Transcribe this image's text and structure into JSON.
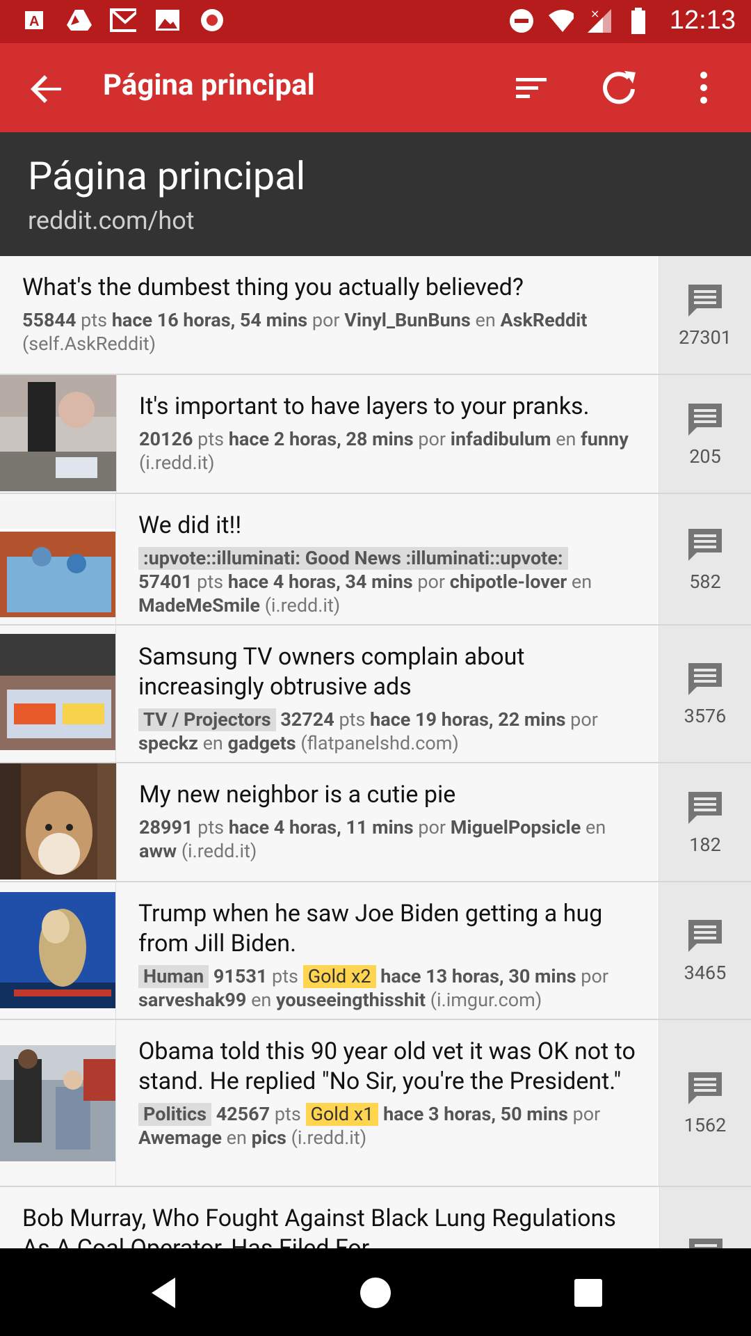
{
  "status_bar": {
    "time": "12:13",
    "left_icons": [
      "adobe-icon",
      "drive-icon",
      "gmail-icon",
      "photos-icon",
      "record-icon"
    ],
    "right_icons": [
      "do-not-disturb-icon",
      "wifi-icon",
      "signal-icon",
      "battery-icon"
    ]
  },
  "app_bar": {
    "title": "Página principal",
    "actions": [
      "sort-icon",
      "refresh-icon",
      "more-vert-icon"
    ]
  },
  "header": {
    "title": "Página principal",
    "subtitle": "reddit.com/hot"
  },
  "posts": [
    {
      "title": "What's the dumbest thing you actually believed?",
      "points": "55844",
      "pts_label": "pts",
      "time": "hace 16 horas, 54 mins",
      "por": "por",
      "author": "Vinyl_BunBuns",
      "en": "en",
      "subreddit": "AskReddit",
      "domain": "(self.AskReddit)",
      "comments": "27301",
      "has_thumb": false
    },
    {
      "title": "It's important to have layers to your pranks.",
      "points": "20126",
      "pts_label": "pts",
      "time": "hace 2 horas, 28 mins",
      "por": "por",
      "author": "infadibulum",
      "en": "en",
      "subreddit": "funny",
      "domain": "(i.redd.it)",
      "comments": "205",
      "has_thumb": true
    },
    {
      "title": "We did it!!",
      "flair": ":upvote::illuminati: Good News :illuminati::upvote:",
      "points": "57401",
      "pts_label": "pts",
      "time": "hace 4 horas, 34 mins",
      "por": "por",
      "author": "chipotle-lover",
      "en": "en",
      "subreddit": "MadeMeSmile",
      "domain": "(i.redd.it)",
      "comments": "582",
      "has_thumb": true
    },
    {
      "title": "Samsung TV owners complain about increasingly obtrusive ads",
      "flair": "TV / Projectors",
      "points": "32724",
      "pts_label": "pts",
      "time": "hace 19 horas, 22 mins",
      "por": "por",
      "author": "speckz",
      "en": "en",
      "subreddit": "gadgets",
      "domain": "(flatpanelshd.com)",
      "comments": "3576",
      "has_thumb": true
    },
    {
      "title": "My new neighbor is a cutie pie",
      "points": "28991",
      "pts_label": "pts",
      "time": "hace 4 horas, 11 mins",
      "por": "por",
      "author": "MiguelPopsicle",
      "en": "en",
      "subreddit": "aww",
      "domain": "(i.redd.it)",
      "comments": "182",
      "has_thumb": true
    },
    {
      "title": "Trump when he saw Joe Biden getting a hug from Jill Biden.",
      "flair": "Human",
      "points": "91531",
      "pts_label": "pts",
      "gold": "Gold x2",
      "time": "hace 13 horas, 30 mins",
      "por": "por",
      "author": "sarveshak99",
      "en": "en",
      "subreddit": "youseeingthisshit",
      "domain": "(i.imgur.com)",
      "comments": "3465",
      "has_thumb": true
    },
    {
      "title": "Obama told this 90 year old vet it was OK not to stand. He replied \"No Sir, you're the President.\"",
      "flair": "Politics",
      "points": "42567",
      "pts_label": "pts",
      "gold": "Gold x1",
      "time": "hace 3 horas, 50 mins",
      "por": "por",
      "author": "Awemage",
      "en": "en",
      "subreddit": "pics",
      "domain": "(i.redd.it)",
      "comments": "1562",
      "has_thumb": true
    },
    {
      "title": "Bob Murray, Who Fought Against Black Lung Regulations As A Coal Operator, Has Filed For",
      "has_thumb": false
    }
  ],
  "nav_bar": [
    "back-icon",
    "home-icon",
    "recents-icon"
  ]
}
